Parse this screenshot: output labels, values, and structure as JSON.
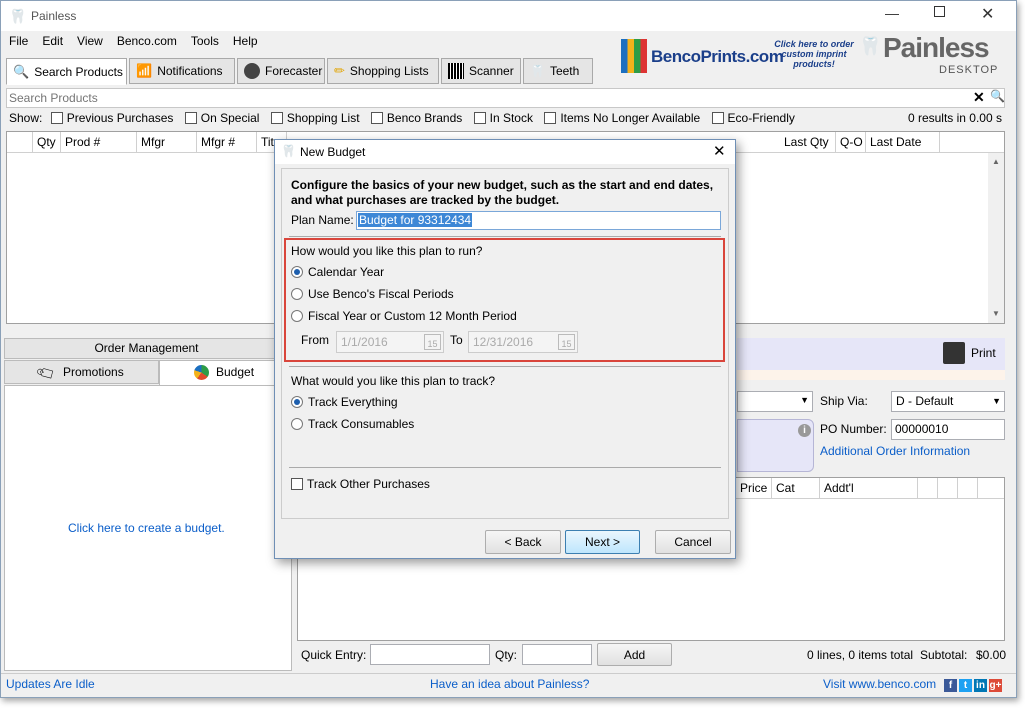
{
  "app": {
    "title": "Painless",
    "logo_main": "Painless",
    "logo_sub": "DESKTOP",
    "banner_name": "BencoPrints.com",
    "banner_promo": "Click here to order custom imprint products!"
  },
  "menu": [
    "File",
    "Edit",
    "View",
    "Benco.com",
    "Tools",
    "Help"
  ],
  "tabs": [
    {
      "label": "Search Products",
      "icon": "magnifier-icon"
    },
    {
      "label": "Notifications",
      "icon": "antenna-icon"
    },
    {
      "label": "Forecaster",
      "icon": "forecaster-icon"
    },
    {
      "label": "Shopping Lists",
      "icon": "pencil-icon"
    },
    {
      "label": "Scanner",
      "icon": "barcode-icon"
    },
    {
      "label": "Teeth",
      "icon": "tooth-icon"
    }
  ],
  "search": {
    "placeholder": "Search Products"
  },
  "filters": {
    "show_label": "Show:",
    "items": [
      "Previous Purchases",
      "On Special",
      "Shopping List",
      "Benco Brands",
      "In Stock",
      "Items No Longer Available",
      "Eco-Friendly"
    ],
    "results": "0 results in 0.00 s"
  },
  "grid": {
    "columns_left": [
      "Qty",
      "Prod #",
      "Mfgr",
      "Mfgr #",
      "Tit"
    ],
    "columns_right": [
      "Last Qty",
      "Q-O",
      "Last Date"
    ]
  },
  "left_panel": {
    "order_mgmt": "Order Management",
    "promotions": "Promotions",
    "budget": "Budget",
    "create_link": "Click here to create a budget."
  },
  "right_panel": {
    "print": "Print",
    "ship_via_label": "Ship Via:",
    "ship_via_value": "D - Default",
    "po_label": "PO Number:",
    "po_value": "00000010",
    "additional_info": "Additional Order Information",
    "columns": [
      "Price",
      "Cat",
      "Addt'l"
    ],
    "quick_entry": "Quick Entry:",
    "qty": "Qty:",
    "add": "Add",
    "lines_summary": "0 lines, 0 items total",
    "subtotal_label": "Subtotal:",
    "subtotal_value": "$0.00"
  },
  "status": {
    "left": "Updates Are Idle",
    "center": "Have an idea about Painless?",
    "right": "Visit www.benco.com",
    "social": [
      "f",
      "t",
      "in",
      "g+"
    ]
  },
  "dialog": {
    "title": "New Budget",
    "intro": "Configure the basics of your new budget, such as the start and end dates, and what purchases are tracked by the budget.",
    "plan_name_label": "Plan Name:",
    "plan_name_value": "Budget for 93312434",
    "run_question": "How would you like this plan to run?",
    "run_options": [
      "Calendar Year",
      "Use Benco's Fiscal Periods",
      "Fiscal Year or Custom 12 Month Period"
    ],
    "from_label": "From",
    "from_value": "1/1/2016",
    "to_label": "To",
    "to_value": "12/31/2016",
    "cal_day": "15",
    "track_question": "What would you like this plan to track?",
    "track_options": [
      "Track Everything",
      "Track Consumables"
    ],
    "other_purchases": "Track Other Purchases",
    "back": "< Back",
    "next": "Next >",
    "cancel": "Cancel"
  },
  "colors": {
    "accent": "#0b5ec9",
    "highlight_border": "#d9453b",
    "panel_blue": "#e6e6f8",
    "selection": "#3d87d6"
  }
}
